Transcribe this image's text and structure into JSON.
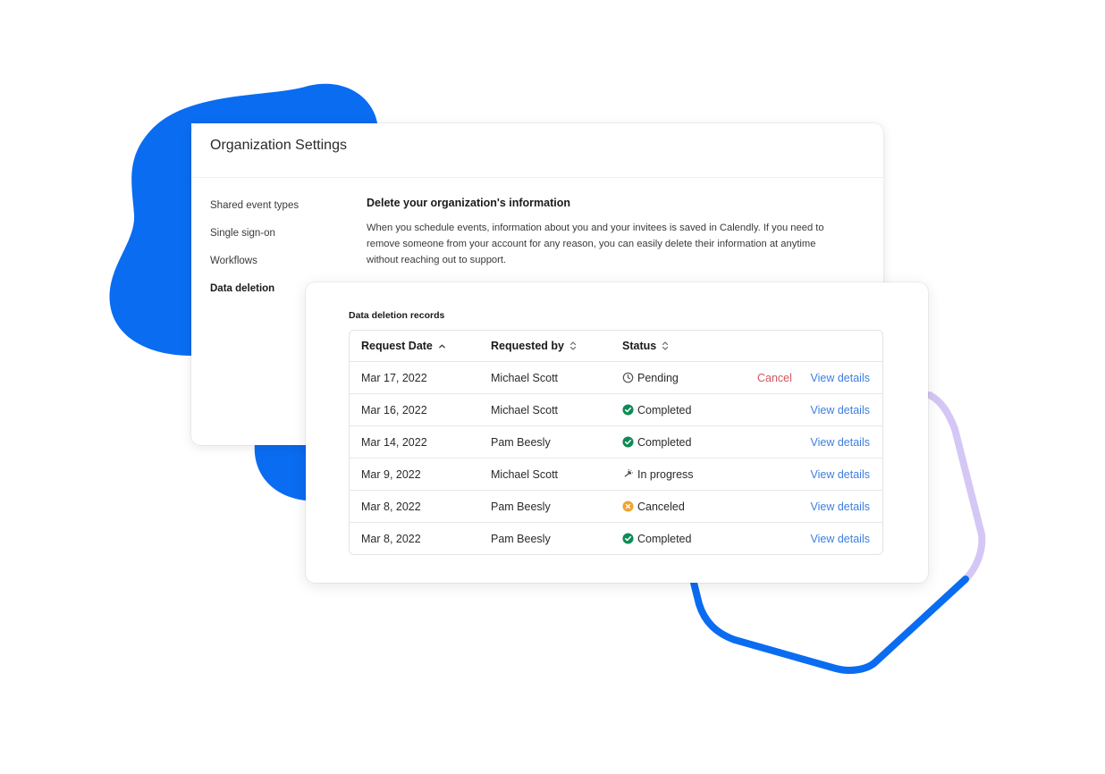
{
  "colors": {
    "brand_blue": "#0a6cf1",
    "lavender": "#d5c7f5",
    "link_blue": "#3d7fe0",
    "cancel_red": "#d0585e",
    "completed_green": "#0f8a57",
    "canceled_orange": "#f0a330"
  },
  "settings": {
    "title": "Organization Settings",
    "nav": [
      {
        "label": "Shared event types",
        "active": false
      },
      {
        "label": "Single sign-on",
        "active": false
      },
      {
        "label": "Workflows",
        "active": false
      },
      {
        "label": "Data deletion",
        "active": true
      }
    ],
    "section_title": "Delete your organization's information",
    "section_text": "When you schedule events, information about you and your invitees is saved in Calendly. If you need to remove someone from your account for any reason, you can easily delete their information at anytime without reaching out to support."
  },
  "records": {
    "title": "Data deletion records",
    "columns": {
      "request_date": "Request Date",
      "requested_by": "Requested by",
      "status": "Status"
    },
    "sort_icons": {
      "request_date": "chevron-up-icon",
      "requested_by": "sort-icon",
      "status": "sort-icon"
    },
    "rows": [
      {
        "date": "Mar 17, 2022",
        "by": "Michael Scott",
        "status": "Pending",
        "status_icon": "clock-icon",
        "cancel": "Cancel",
        "view": "View details"
      },
      {
        "date": "Mar 16, 2022",
        "by": "Michael Scott",
        "status": "Completed",
        "status_icon": "check-circle-icon",
        "view": "View details"
      },
      {
        "date": "Mar 14, 2022",
        "by": "Pam Beesly",
        "status": "Completed",
        "status_icon": "check-circle-icon",
        "view": "View details"
      },
      {
        "date": "Mar 9, 2022",
        "by": "Michael Scott",
        "status": "In progress",
        "status_icon": "progress-icon",
        "view": "View details"
      },
      {
        "date": "Mar 8, 2022",
        "by": "Pam Beesly",
        "status": "Canceled",
        "status_icon": "x-circle-icon",
        "view": "View details"
      },
      {
        "date": "Mar 8, 2022",
        "by": "Pam Beesly",
        "status": "Completed",
        "status_icon": "check-circle-icon",
        "view": "View details"
      }
    ]
  }
}
